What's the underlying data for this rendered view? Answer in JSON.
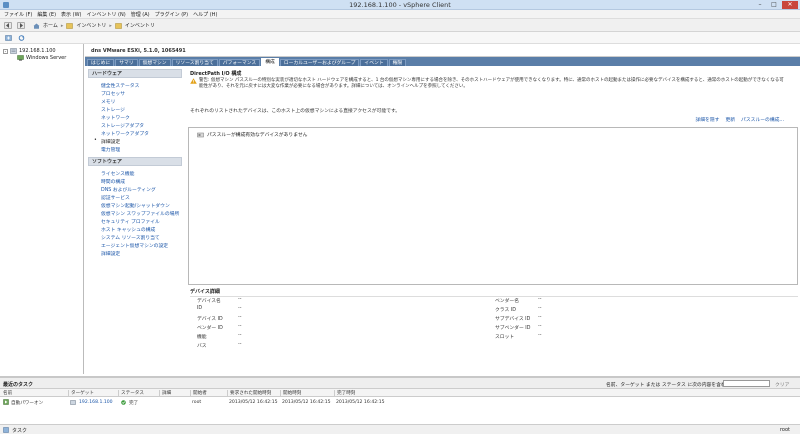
{
  "window": {
    "title": "192.168.1.100 - vSphere Client"
  },
  "menu": [
    "ファイル (F)",
    "編集 (E)",
    "表示 (W)",
    "インベントリ (N)",
    "管理 (A)",
    "プラグイン (P)",
    "ヘルプ (H)"
  ],
  "breadcrumb": {
    "home": "ホーム",
    "inventory1": "インベントリ",
    "inventory2": "インベントリ"
  },
  "tree": {
    "host": "192.168.1.100",
    "vm": "Windows Server"
  },
  "host_header": "dns VMware ESXi, 5.1.0, 1065491",
  "tabs": [
    "はじめに",
    "サマリ",
    "仮想マシン",
    "リソース割り当て",
    "パフォーマンス",
    "構成",
    "ローカルユーザーおよびグループ",
    "イベント",
    "権限"
  ],
  "active_tab": "構成",
  "hardware": {
    "header": "ハードウェア",
    "items": [
      "健全性ステータス",
      "プロセッサ",
      "メモリ",
      "ストレージ",
      "ネットワーク",
      "ストレージアダプタ",
      "ネットワークアダプタ",
      "詳細設定",
      "電力管理"
    ],
    "selected": "詳細設定"
  },
  "software": {
    "header": "ソフトウェア",
    "items": [
      "ライセンス機能",
      "時間の構成",
      "DNS およびルーティング",
      "認証サービス",
      "仮想マシン起動/シャットダウン",
      "仮想マシン スワップファイルの場所",
      "セキュリティ プロファイル",
      "ホスト キャッシュの構成",
      "システム リソース割り当て",
      "エージェント仮想マシンの設定",
      "詳細設定"
    ]
  },
  "content": {
    "title": "DirectPath I/O 構成",
    "warning": "警告: 仮想マシン パススルーの特別な実装が適切なホスト ハードウェアを構成すると、1 台の仮想マシン専用にする場合を除き、そのホストハードウェアが使用できなくなります。特に、通常のホストの起動または操作に必要なデバイスを構成すると、通常のホストの起動ができなくなる可能性があり、それを元に戻すには大変な作業が必要になる場合があります。詳細については、オンラインヘルプを参照してください。",
    "listed_text": "それぞれのリストされたデバイスは、このホスト上の仮想マシンによる直接アクセスが可能です。",
    "links": [
      "詳細を隠す",
      "更新",
      "パススルーの構成..."
    ],
    "no_devices": "パススルーが構成有効なデバイスがありません"
  },
  "details": {
    "header": "デバイス詳細",
    "left": [
      {
        "label": "デバイス名",
        "value": "--"
      },
      {
        "label": "ID",
        "value": "--"
      },
      {
        "label": "デバイス ID",
        "value": "--"
      },
      {
        "label": "ベンダー ID",
        "value": "--"
      },
      {
        "label": "機能",
        "value": "--"
      },
      {
        "label": "バス",
        "value": "--"
      }
    ],
    "right": [
      {
        "label": "ベンダー名",
        "value": "--"
      },
      {
        "label": "クラス ID",
        "value": "--"
      },
      {
        "label": "サブデバイス ID",
        "value": "--"
      },
      {
        "label": "サブベンダー ID",
        "value": "--"
      },
      {
        "label": "スロット",
        "value": "--"
      }
    ]
  },
  "tasks": {
    "header": "最近のタスク",
    "filter_label": "名前、ターゲット または ステータス に次の内容を含む：",
    "filter_value": "",
    "clear": "クリア",
    "columns": [
      "名前",
      "ターゲット",
      "ステータス",
      "詳細",
      "開始者",
      "要求された開始時刻",
      "開始時刻",
      "完了時刻"
    ],
    "rows": [
      {
        "name": "自動パワーオン",
        "target": "192.168.1.100",
        "status": "完了",
        "details": "",
        "initiator": "root",
        "requested": "2013/05/12 16:42:15",
        "start": "2013/05/12 16:42:15",
        "completed": "2013/05/12 16:42:15"
      }
    ]
  },
  "status": {
    "left": "タスク",
    "right": "root"
  },
  "colors": {
    "tab_bar": "#5a7ea8",
    "link": "#1a55a8",
    "title_bar": "#cfe0f3",
    "close": "#c9463d",
    "success": "#3a9a3a",
    "warning": "#e3a21a"
  }
}
